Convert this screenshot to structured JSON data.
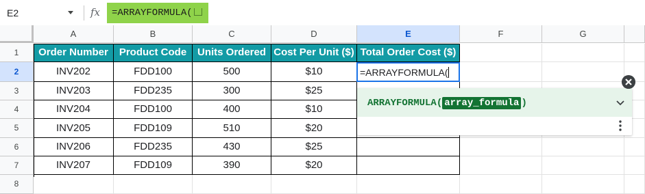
{
  "formula_bar": {
    "name_box": "E2",
    "fx_label": "fx",
    "formula": "=ARRAYFORMULA("
  },
  "columns": [
    "A",
    "B",
    "C",
    "D",
    "E",
    "F",
    "G"
  ],
  "selected_column": "E",
  "rows": [
    "1",
    "2",
    "3",
    "4",
    "5",
    "6",
    "7",
    "8"
  ],
  "selected_row": "2",
  "table": {
    "headers": [
      "Order Number",
      "Product Code",
      "Units Ordered",
      "Cost Per Unit ($)",
      "Total Order Cost ($)"
    ],
    "data": [
      [
        "INV202",
        "FDD100",
        "500",
        "$10"
      ],
      [
        "INV203",
        "FDD235",
        "300",
        "$25"
      ],
      [
        "INV204",
        "FDD100",
        "400",
        "$10"
      ],
      [
        "INV205",
        "FDD109",
        "510",
        "$20"
      ],
      [
        "INV206",
        "FDD235",
        "430",
        "$25"
      ],
      [
        "INV207",
        "FDD109",
        "390",
        "$20"
      ]
    ]
  },
  "active_cell": {
    "ref": "E2",
    "text": "=ARRAYFORMULA("
  },
  "autocomplete": {
    "function_name": "ARRAYFORMULA(",
    "argument": "array_formula",
    "closing": ")"
  },
  "colors": {
    "header_fill": "#139ba5",
    "formula_highlight": "#8fd34a",
    "selection_blue": "#1a73e8",
    "popup_green": "#137333"
  },
  "icons": [
    "chevron-down-icon",
    "fx-icon",
    "expand-icon",
    "more-vert-icon",
    "close-icon"
  ]
}
